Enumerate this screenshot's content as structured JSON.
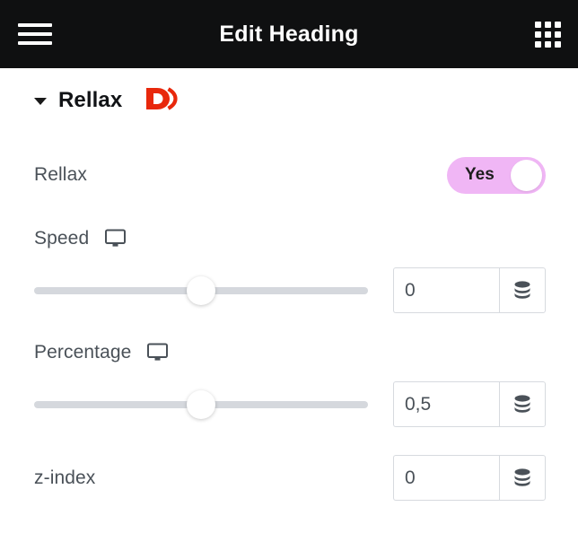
{
  "topbar": {
    "title": "Edit Heading",
    "menu_icon": "hamburger-menu-icon",
    "apps_icon": "grid-apps-icon",
    "background": "#0f1011"
  },
  "section": {
    "title": "Rellax",
    "caret_icon": "chevron-down-icon",
    "brand_logo": "rellax-d-logo",
    "brand_color": "#e8280c"
  },
  "controls": {
    "rellax_toggle": {
      "label": "Rellax",
      "value": "Yes",
      "state": "on",
      "track_color": "#f0b6f5",
      "knob_color": "#ffffff"
    },
    "speed": {
      "label": "Speed",
      "device_icon": "desktop-monitor-icon",
      "slider_percent": 50,
      "value": "0",
      "db_icon": "database-stack-icon"
    },
    "percentage": {
      "label": "Percentage",
      "device_icon": "desktop-monitor-icon",
      "slider_percent": 50,
      "value": "0,5",
      "db_icon": "database-stack-icon"
    },
    "z_index": {
      "label": "z-index",
      "value": "0",
      "db_icon": "database-stack-icon"
    }
  }
}
